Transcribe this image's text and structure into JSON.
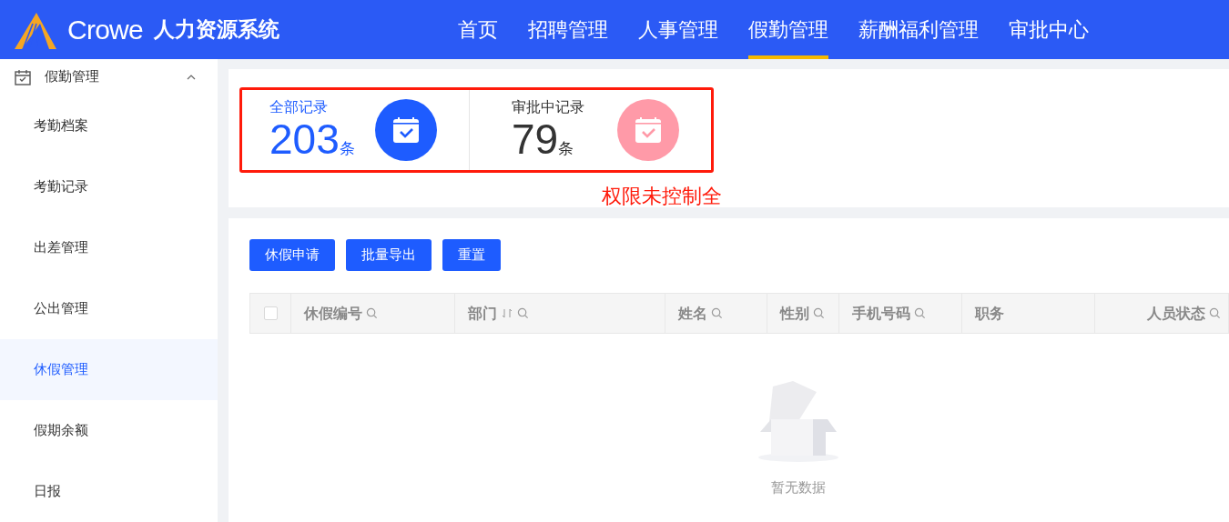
{
  "header": {
    "brand": "Crowe",
    "system_name": "人力资源系统",
    "nav": [
      {
        "label": "首页",
        "selected": false
      },
      {
        "label": "招聘管理",
        "selected": false
      },
      {
        "label": "人事管理",
        "selected": false
      },
      {
        "label": "假勤管理",
        "selected": true
      },
      {
        "label": "薪酬福利管理",
        "selected": false
      },
      {
        "label": "审批中心",
        "selected": false
      }
    ]
  },
  "sidebar": {
    "group": {
      "label": "假勤管理",
      "expanded": true
    },
    "items": [
      {
        "label": "考勤档案",
        "selected": false
      },
      {
        "label": "考勤记录",
        "selected": false
      },
      {
        "label": "出差管理",
        "selected": false
      },
      {
        "label": "公出管理",
        "selected": false
      },
      {
        "label": "休假管理",
        "selected": true
      },
      {
        "label": "假期余额",
        "selected": false
      },
      {
        "label": "日报",
        "selected": false
      }
    ]
  },
  "stats": [
    {
      "label": "全部记录",
      "value": "203",
      "unit": "条",
      "color": "#1e5cff"
    },
    {
      "label": "审批中记录",
      "value": "79",
      "unit": "条",
      "color": "#ff9aa8"
    }
  ],
  "annotation": "权限未控制全",
  "toolbar": [
    "休假申请",
    "批量导出",
    "重置"
  ],
  "table": {
    "select_all": {
      "checked": false
    },
    "columns": [
      {
        "label": "休假编号",
        "kind": "search"
      },
      {
        "label": "部门",
        "kind": "sort-search"
      },
      {
        "label": "姓名",
        "kind": "search"
      },
      {
        "label": "性别",
        "kind": "search"
      },
      {
        "label": "手机号码",
        "kind": "search"
      },
      {
        "label": "职务",
        "kind": "plain"
      },
      {
        "label": "人员状态",
        "kind": "search"
      }
    ],
    "empty_text": "暂无数据"
  }
}
